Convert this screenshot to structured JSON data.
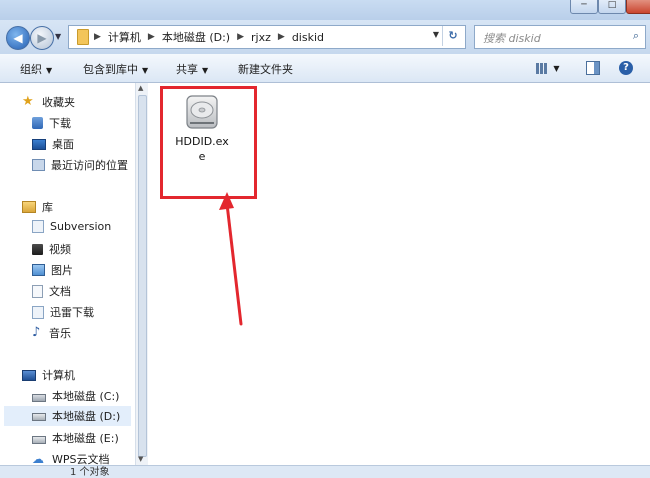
{
  "window": {
    "minimize_label": "─",
    "maximize_label": "□"
  },
  "address": {
    "crumbs": [
      "计算机",
      "本地磁盘 (D:)",
      "rjxz",
      "diskid"
    ],
    "search_placeholder": "搜索 diskid"
  },
  "toolbar": {
    "organize": "组织",
    "include_in_library": "包含到库中",
    "share": "共享",
    "new_folder": "新建文件夹"
  },
  "sidebar": {
    "favorites": {
      "label": "收藏夹",
      "items": [
        "下载",
        "桌面",
        "最近访问的位置"
      ]
    },
    "library": {
      "label": "库",
      "items": [
        "Subversion",
        "视频",
        "图片",
        "文档",
        "迅雷下载",
        "音乐"
      ]
    },
    "computer": {
      "label": "计算机",
      "items": [
        "本地磁盘 (C:)",
        "本地磁盘 (D:)",
        "本地磁盘 (E:)",
        "WPS云文档"
      ],
      "selected_index": 1
    }
  },
  "status": {
    "count_text": "1 个对象"
  },
  "files": [
    {
      "name_line1": "HDDID.ex",
      "name_line2": "e",
      "icon": "hard-drive-icon"
    }
  ],
  "colors": {
    "annotation": "#e3272e",
    "accent": "#245fb3"
  }
}
